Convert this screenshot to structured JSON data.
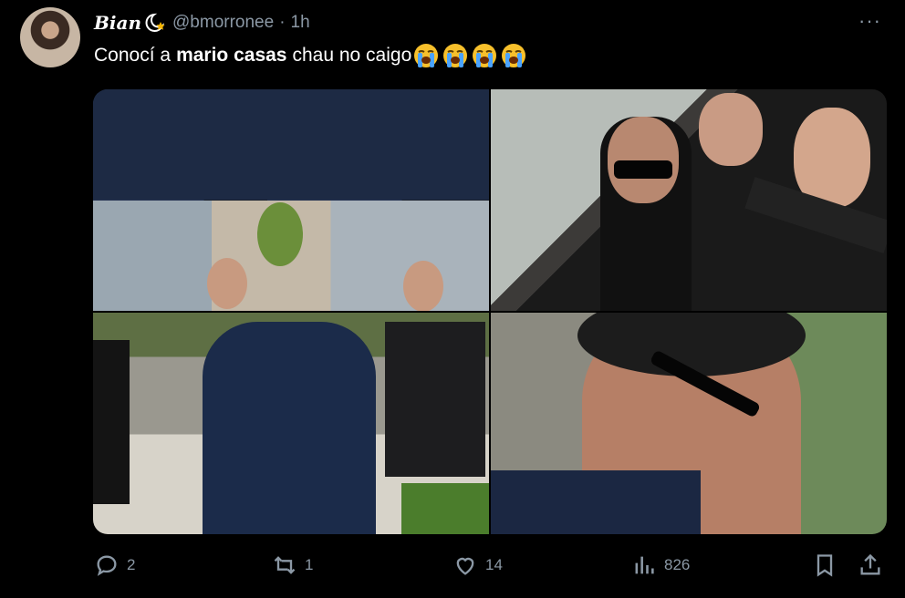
{
  "tweet": {
    "display_name": "Bian",
    "handle": "@bmorronee",
    "separator": "·",
    "time": "1h",
    "more": "···",
    "text_before": "Conocí a",
    "text_bold": "mario casas",
    "text_after": "chau no caigo",
    "emoji_count": 4
  },
  "actions": {
    "replies": "2",
    "retweets": "1",
    "likes": "14",
    "views": "826"
  },
  "colors": {
    "background": "#000000",
    "text": "#e7e9ea",
    "muted": "#8b98a5"
  }
}
